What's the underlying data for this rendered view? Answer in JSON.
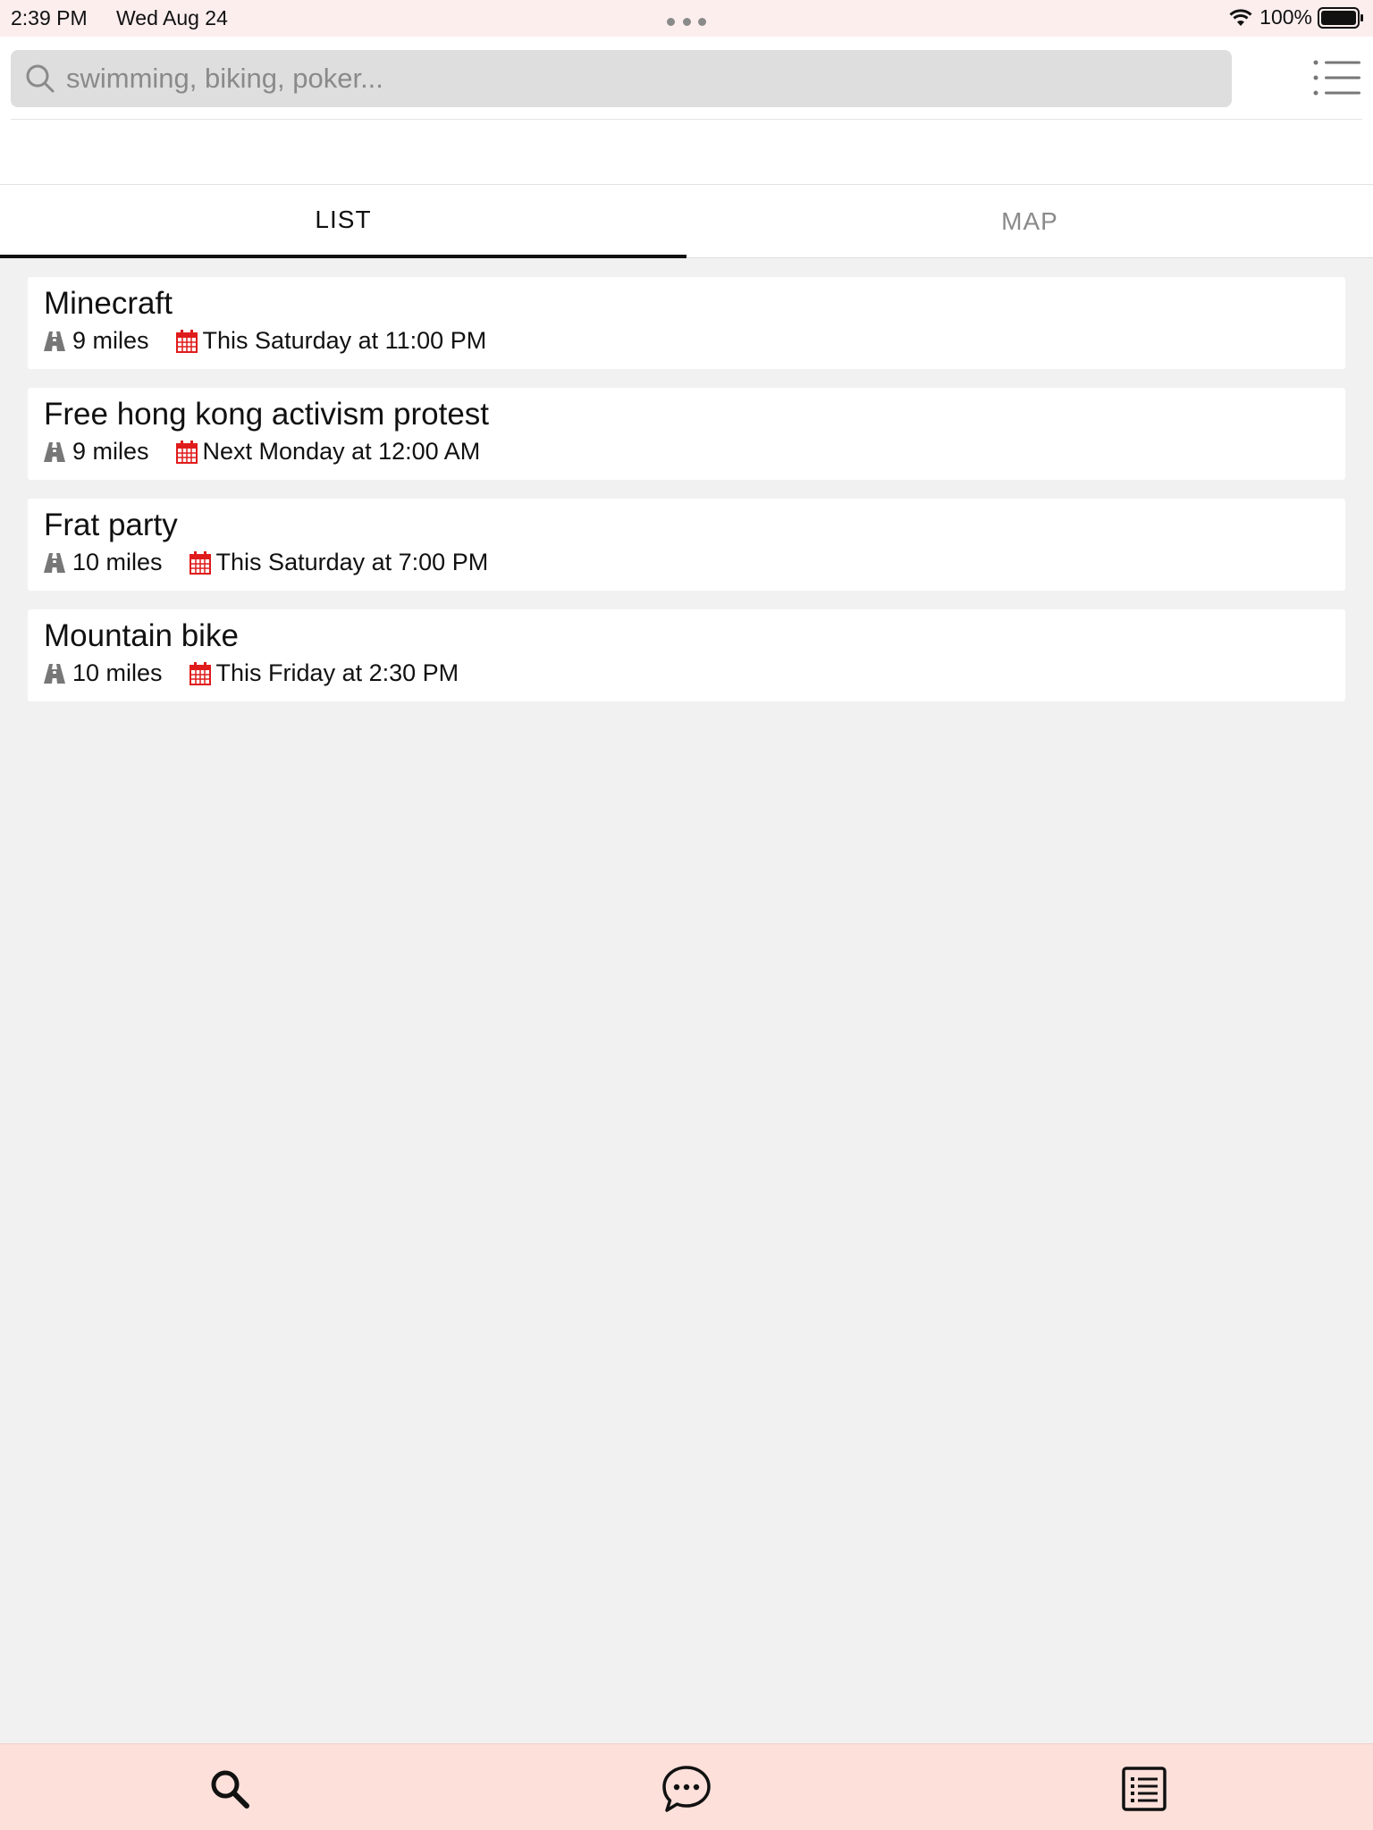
{
  "status_bar": {
    "time": "2:39 PM",
    "date": "Wed Aug 24",
    "battery": "100%"
  },
  "search": {
    "value": "",
    "placeholder": "swimming, biking, poker..."
  },
  "tabs": [
    {
      "label": "LIST",
      "active": true
    },
    {
      "label": "MAP",
      "active": false
    }
  ],
  "events": [
    {
      "title": "Minecraft",
      "distance": "9 miles",
      "when": "This Saturday at 11:00 PM"
    },
    {
      "title": "Free hong kong activism protest",
      "distance": "9 miles",
      "when": "Next Monday at 12:00 AM"
    },
    {
      "title": "Frat party",
      "distance": "10 miles",
      "when": "This Saturday at 7:00 PM"
    },
    {
      "title": "Mountain bike",
      "distance": "10 miles",
      "when": "This Friday at 2:30 PM"
    }
  ],
  "icons": {
    "distance": "road-icon",
    "date": "calendar-icon",
    "bottom_nav": [
      "search-icon",
      "chat-bubble-icon",
      "list-icon"
    ]
  },
  "colors": {
    "status_bar_bg": "#fdeeee",
    "bottom_bar_bg": "#fde0da",
    "calendar_red": "#e01b1b",
    "road_gray": "#777777",
    "active_tab": "#111111",
    "inactive_tab": "#8a8a8a"
  }
}
